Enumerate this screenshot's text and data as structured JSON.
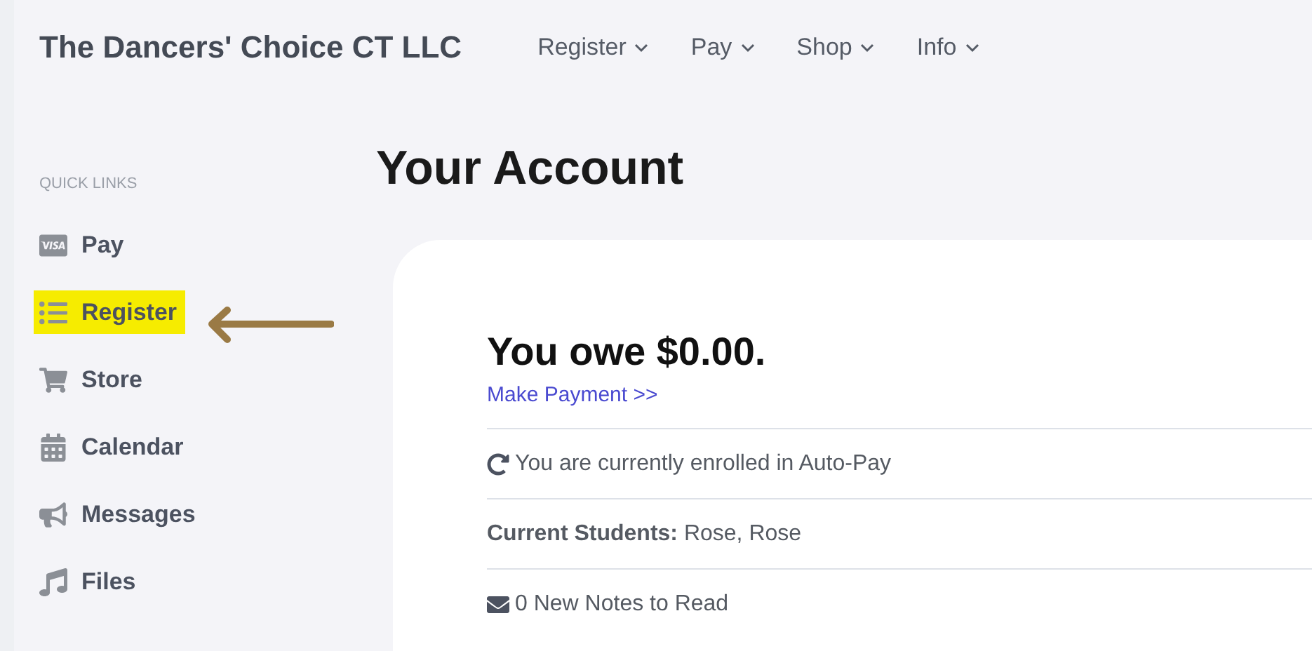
{
  "header": {
    "brand": "The Dancers' Choice CT LLC",
    "menu": [
      {
        "label": "Register"
      },
      {
        "label": "Pay"
      },
      {
        "label": "Shop"
      },
      {
        "label": "Info"
      }
    ]
  },
  "sidebar": {
    "heading": "QUICK LINKS",
    "items": [
      {
        "label": "Pay",
        "highlighted": false
      },
      {
        "label": "Register",
        "highlighted": true
      },
      {
        "label": "Store",
        "highlighted": false
      },
      {
        "label": "Calendar",
        "highlighted": false
      },
      {
        "label": "Messages",
        "highlighted": false
      },
      {
        "label": "Files",
        "highlighted": false
      }
    ]
  },
  "page_title": "Your Account",
  "account": {
    "balance": "You owe $0.00.",
    "payment_link": "Make Payment >>",
    "rows": [
      {
        "kind": "icon",
        "text": "You are currently enrolled in Auto-Pay"
      },
      {
        "kind": "labeled",
        "label": "Current Students:",
        "value": "Rose, Rose"
      },
      {
        "kind": "icon",
        "text": "0 New Notes to Read"
      }
    ]
  }
}
